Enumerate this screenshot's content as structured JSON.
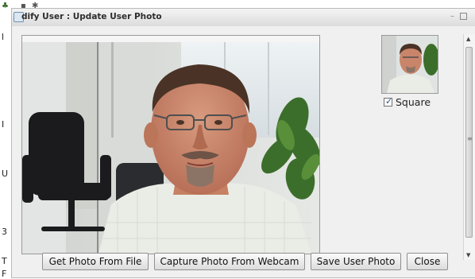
{
  "background": {
    "side_chars": [
      "l",
      "I",
      "U",
      "3",
      "T",
      "F"
    ]
  },
  "dialog": {
    "title": "dify User : Update User Photo",
    "window_controls": {
      "minimize": "–",
      "maximize": "□"
    }
  },
  "preview": {
    "square_label": "Square",
    "square_checked": true
  },
  "buttons": {
    "get_photo": "Get Photo From File",
    "capture": "Capture Photo From Webcam",
    "save": "Save User Photo",
    "close": "Close"
  },
  "colors": {
    "dialog_bg": "#f0f0f0",
    "button_border": "#8f8f8f",
    "checkbox_check": "#2a4f8a"
  },
  "icons": {
    "title": "window-icon",
    "checkbox": "checkmark-icon",
    "scroll_up": "arrow-up-icon",
    "scroll_down": "arrow-down-icon"
  }
}
